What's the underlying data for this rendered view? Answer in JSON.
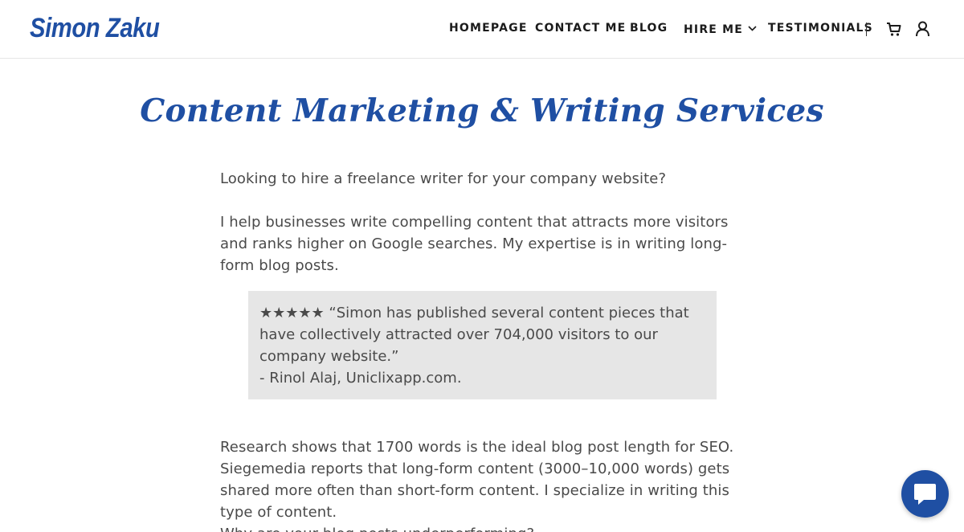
{
  "header": {
    "logo": "Simon Zaku",
    "nav": [
      {
        "label": "HOMEPAGE"
      },
      {
        "label": "CONTACT ME"
      },
      {
        "label": "BLOG"
      },
      {
        "label": "HIRE ME"
      },
      {
        "label": "TESTIMONIALS"
      }
    ],
    "icons": [
      "cart-icon",
      "account-icon",
      "chevron-down-icon"
    ]
  },
  "main": {
    "title": "Content Marketing & Writing Services",
    "para1": "Looking to hire a freelance writer for your company website?",
    "para2": "I help businesses write compelling content that attracts more visitors and ranks higher on Google searches. My expertise is in writing long-form blog posts.",
    "testimonial": {
      "stars": "★★★★★",
      "quote": " “Simon has published several content pieces that have collectively attracted over 704,000 visitors to our company website.”",
      "author": "- Rinol Alaj, Uniclixapp.com."
    },
    "para3": "Research shows that 1700 words is the ideal blog post length for SEO. Siegemedia reports that long-form content (3000–10,000 words) gets shared more often than short-form content. I specialize in writing this type of content.",
    "para4": "Why are your blog posts underperforming?"
  },
  "chat": {
    "icon": "chat-bubble-icon"
  },
  "colors": {
    "brand": "#1f4fa3",
    "quote_bg": "#e6e6e6",
    "text": "#4a4a4a"
  }
}
